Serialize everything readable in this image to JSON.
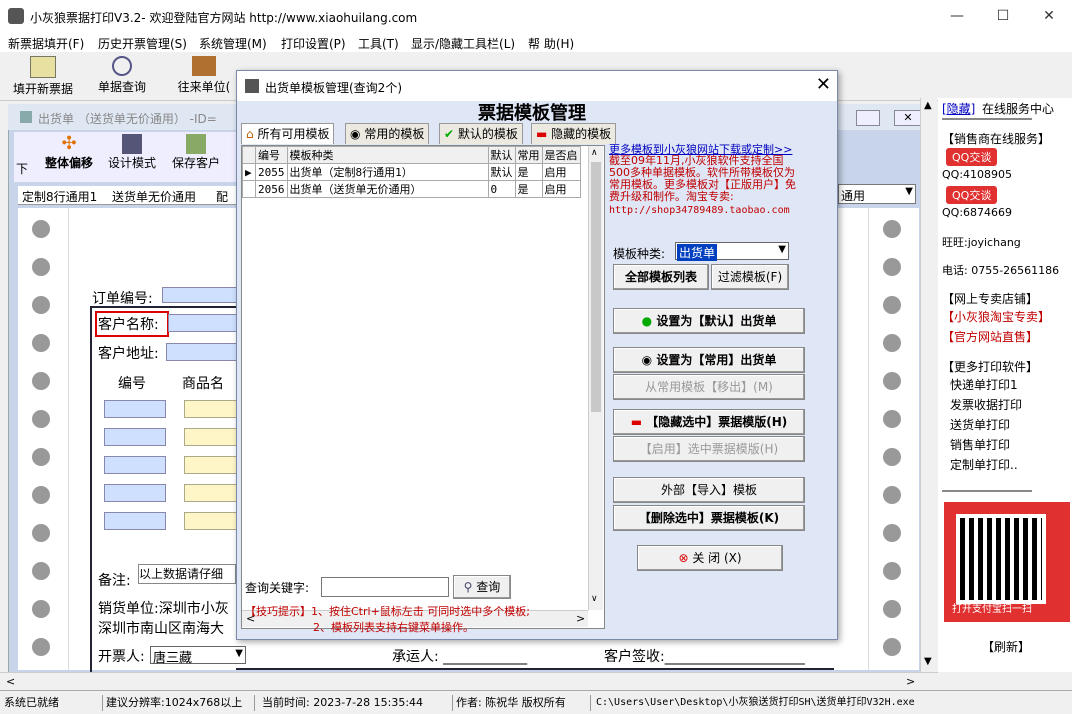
{
  "window": {
    "title": "小灰狼票据打印V3.2- 欢迎登陆官方网站 http://www.xiaohuilang.com"
  },
  "menu": [
    "新票据填开(F)",
    "历史开票管理(S)",
    "系统管理(M)",
    "打印设置(P)",
    "工具(T)",
    "显示/隐藏工具栏(L)",
    "帮 助(H)"
  ],
  "toolbar": {
    "new_bill": "填开新票据",
    "query": "单据查询",
    "partner": "往来单位("
  },
  "child": {
    "title": "出货单 （送货单无价通用） -ID=",
    "btn_move": "整体偏移",
    "btn_design": "设计模式",
    "btn_save_customer": "保存客户",
    "btn_down": "下",
    "tpl_tab1": "定制8行通用1",
    "tpl_tab2": "送货单无价通用",
    "tpl_tab3": "配",
    "combo_right": "通用",
    "order_no": "订单编号:",
    "customer_name": "客户名称:",
    "customer_addr": "客户地址:",
    "col_no": "编号",
    "col_name": "商品名",
    "remark": "备注:",
    "remark_value": "以上数据请仔细",
    "seller": "销货单位:深圳市小灰",
    "seller_addr": "深圳市南山区南海大",
    "issuer": "开票人:",
    "issuer_value": "唐三藏",
    "carrier": "承运人: ____________",
    "sign": "客户签收:____________________"
  },
  "right_panel": {
    "hide": "[隐藏]",
    "service": "在线服务中心",
    "sales_online": "【销售商在线服务】",
    "qq_btn": "QQ交谈",
    "qq1": "QQ:4108905",
    "qq2": "QQ:6874669",
    "wangwang": "旺旺:joyichang",
    "phone": "电话: 0755-26561186",
    "shop": "【网上专卖店铺】",
    "taobao": "【小灰狼淘宝专卖】",
    "official": "【官方网站直售】",
    "more_soft": "【更多打印软件】",
    "soft": [
      "快递单打印1",
      "发票收据打印",
      "送货单打印",
      "销售单打印",
      "定制单打印.."
    ],
    "qr_caption": "打开支付宝扫一扫",
    "refresh": "【刷新】"
  },
  "dialog": {
    "title": "出货单模板管理(查询2个)",
    "heading": "票据模板管理",
    "tabs": [
      "所有可用模板",
      "常用的模板",
      "默认的模板",
      "隐藏的模板"
    ],
    "columns": [
      "编号",
      "模板种类",
      "默认",
      "常用",
      "是否启"
    ],
    "rows": [
      {
        "id": "2055",
        "name": "出货单（定制8行通用1）",
        "def": "默认",
        "common": "是",
        "enabled": "启用"
      },
      {
        "id": "2056",
        "name": "出货单（送货单无价通用）",
        "def": "0",
        "common": "是",
        "enabled": "启用"
      }
    ],
    "download_link": "更多模板到小灰狼网站下载或定制>>",
    "info": "截至09年11月,小灰狼软件支持全国500多种单据模板。软件所带模板仅为常用模板。更多模板对【正版用户】免费升级和制作。淘宝专卖:",
    "shop_url": "http://shop34789489.taobao.com",
    "type_label": "模板种类:",
    "type_value": "出货单",
    "btn_all": "全部模板列表",
    "btn_filter": "过滤模板(F)",
    "btn_set_default": "设置为【默认】出货单",
    "btn_set_common": "设置为【常用】出货单",
    "btn_remove_common": "从常用模板【移出】(M)",
    "btn_hide": "【隐藏选中】票据模版(H)",
    "btn_enable": "【启用】选中票据模版(H)",
    "btn_import": "外部【导入】模板",
    "btn_delete": "【删除选中】票据模板(K)",
    "btn_close": "关  闭 (X)",
    "keyword_label": "查询关键字:",
    "keyword_value": "",
    "btn_query": "查询",
    "tip1": "【技巧提示】1、按住Ctrl+鼠标左击 可同时选中多个模板;",
    "tip2": "2、模板列表支持右键菜单操作。"
  },
  "status": {
    "ready": "系统已就绪",
    "resolution": "建议分辨率:1024x768以上",
    "time": "当前时间: 2023-7-28 15:35:44",
    "author": "作者: 陈祝华 版权所有",
    "path": "C:\\Users\\User\\Desktop\\小灰狼送货打印SH\\送货单打印V32H.exe"
  },
  "colors": {
    "dialog_bg": "#dfe6f5",
    "accent_red": "#c00000",
    "link_blue": "#0000c0"
  }
}
